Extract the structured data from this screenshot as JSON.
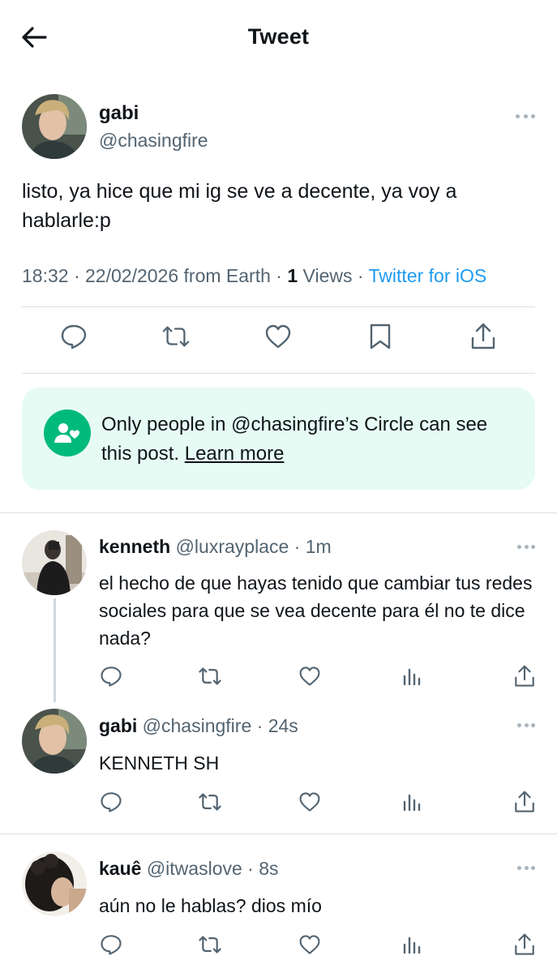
{
  "header": {
    "title": "Tweet"
  },
  "main_tweet": {
    "name": "gabi",
    "handle": "@chasingfire",
    "text": "listo, ya hice que mi ig se ve a decente, ya voy a hablarle:p",
    "time": "18:32",
    "date": "22/02/2026 from Earth",
    "views_count": "1",
    "views_label": "Views",
    "client": "Twitter for iOS"
  },
  "circle_notice": {
    "text": "Only people in @chasingfire’s Circle can see this post.",
    "link": "Learn more"
  },
  "replies": [
    {
      "name": "kenneth",
      "handle": "@luxrayplace",
      "time": "1m",
      "text": "el hecho de que hayas tenido que cambiar tus redes sociales para que se vea decente para él no te dice nada?"
    },
    {
      "name": "gabi",
      "handle": "@chasingfire",
      "time": "24s",
      "text": "KENNETH SH"
    },
    {
      "name": "kauê",
      "handle": "@itwaslove",
      "time": "8s",
      "text": "aún no le hablas? dios mío"
    }
  ],
  "meta_separator": "·",
  "colors": {
    "accent": "#1d9bf0",
    "circle_green": "#00ba7c",
    "circle_bg": "#e6fbf3",
    "secondary_text": "#536471"
  }
}
